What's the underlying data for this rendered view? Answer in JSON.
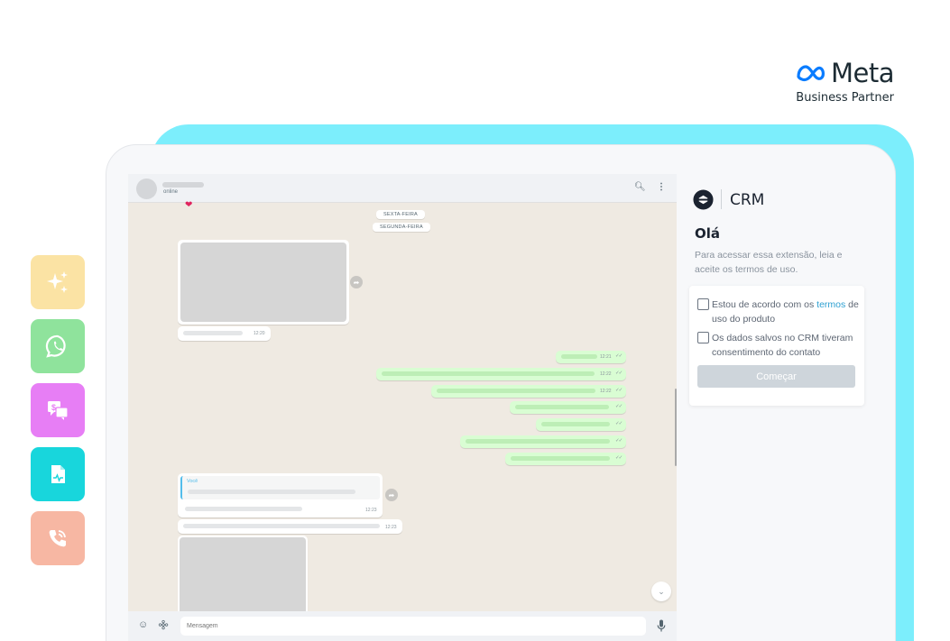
{
  "brand": {
    "meta_word": "Meta",
    "meta_subtitle": "Business Partner"
  },
  "side_icons": [
    {
      "name": "sparkle-icon",
      "color": "#fbe3a4"
    },
    {
      "name": "whatsapp-icon",
      "color": "#8fe39c"
    },
    {
      "name": "payment-chat-icon",
      "color": "#e77ef5"
    },
    {
      "name": "document-icon",
      "color": "#18d6dc"
    },
    {
      "name": "phone-icon",
      "color": "#f7b7a3"
    }
  ],
  "chat": {
    "contact_status": "online",
    "dates": [
      "SEXTA-FEIRA",
      "SEGUNDA-FEIRA"
    ],
    "timestamps": {
      "image_in": "12:20",
      "out_1": "12:21",
      "out_2": "12:22",
      "out_3": "12:22",
      "reply": "12:23",
      "in_2": "12:23"
    },
    "quote_author": "Você",
    "composer_placeholder": "Mensagem"
  },
  "crm": {
    "title": "CRM",
    "greeting": "Olá",
    "intro": "Para acessar essa extensão, leia e aceite os termos de uso.",
    "terms_prefix": "Estou de acordo com os ",
    "terms_link": "termos",
    "terms_suffix": " de uso do produto",
    "consent_label": "Os dados salvos no CRM tiveram consentimento do contato",
    "start_button": "Começar"
  },
  "colors": {
    "cyan_backdrop": "#7ceefc",
    "bubble_out": "#d9fdd3",
    "link": "#2c9fd1",
    "button_disabled": "#ced5db"
  }
}
